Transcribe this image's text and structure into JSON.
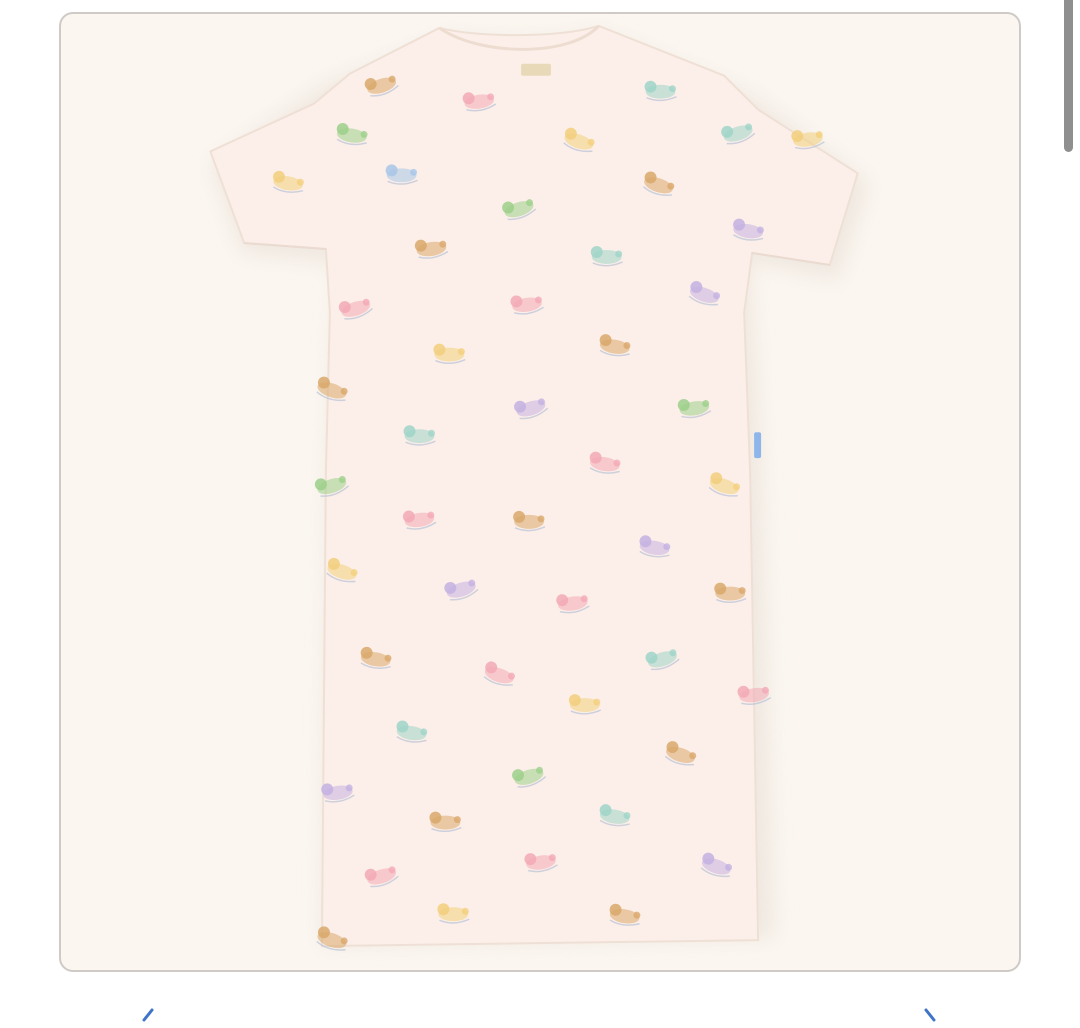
{
  "product": {
    "image_description_name": "dress-image",
    "garment_color": "#fcefe9",
    "background_color": "#fbf6f0",
    "border_color": "#cfcac6",
    "neck_label_color": "#e8d9b8",
    "side_tag_color": "#8fb6ea"
  },
  "pattern": {
    "motif_colors": {
      "bear": "#d9a86a",
      "pink": "#f2a9b6",
      "yellow": "#f2cf7c",
      "blue": "#a8c6e8",
      "lilac": "#c4b0e2",
      "green": "#9ccf8a",
      "mint": "#9fd4c8"
    }
  },
  "navigation": {
    "arrow_color": "#3f74c9",
    "prev_icon": "chevron-left-icon",
    "next_icon": "chevron-right-icon"
  },
  "scrollbar": {
    "color": "#8f8f8f"
  }
}
